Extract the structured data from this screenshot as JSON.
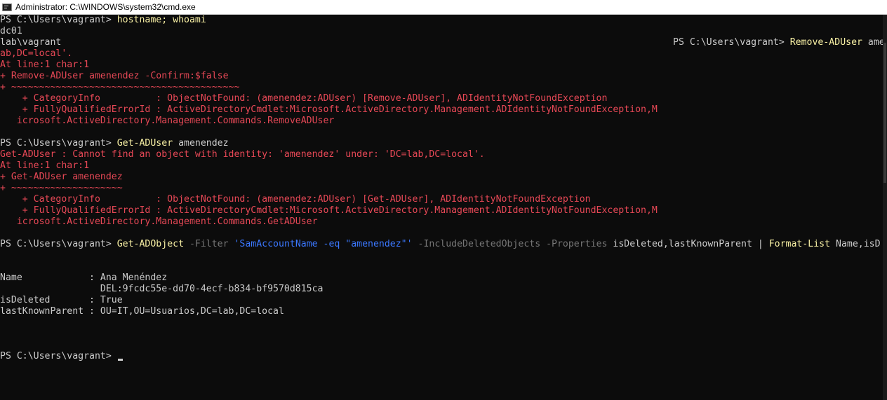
{
  "window": {
    "title": "Administrator: C:\\WINDOWS\\system32\\cmd.exe",
    "icon": "console-icon"
  },
  "terminal": {
    "colors": {
      "background": "#0c0c0c",
      "text": "#cccccc",
      "command": "#f9f1a5",
      "error": "#e74856",
      "parameter": "#767676",
      "string": "#3b78ff"
    },
    "prompt": "PS C:\\Users\\vagrant> ",
    "cmd1": {
      "command": "hostname; whoami"
    },
    "out1": [
      "dc01",
      "lab\\vagrant"
    ],
    "wrapped_prompt": "PS C:\\Users\\vagrant> ",
    "wrapped_command": "Remove-ADUser",
    "wrapped_arg": " ame",
    "err1": [
      "ab,DC=local'.",
      "At line:1 char:1",
      "+ Remove-ADUser amenendez -Confirm:$false",
      "+ ~~~~~~~~~~~~~~~~~~~~~~~~~~~~~~~~~~~~~~~~~",
      "    + CategoryInfo          : ObjectNotFound: (amenendez:ADUser) [Remove-ADUser], ADIdentityNotFoundException",
      "    + FullyQualifiedErrorId : ActiveDirectoryCmdlet:Microsoft.ActiveDirectory.Management.ADIdentityNotFoundException,M",
      "   icrosoft.ActiveDirectory.Management.Commands.RemoveADUser"
    ],
    "cmd2": {
      "command": "Get-ADUser",
      "args": " amenendez"
    },
    "err2": [
      "Get-ADUser : Cannot find an object with identity: 'amenendez' under: 'DC=lab,DC=local'.",
      "At line:1 char:1",
      "+ Get-ADUser amenendez",
      "+ ~~~~~~~~~~~~~~~~~~~~",
      "    + CategoryInfo          : ObjectNotFound: (amenendez:ADUser) [Get-ADUser], ADIdentityNotFoundException",
      "    + FullyQualifiedErrorId : ActiveDirectoryCmdlet:Microsoft.ActiveDirectory.Management.ADIdentityNotFoundException,M",
      "   icrosoft.ActiveDirectory.Management.Commands.GetADUser"
    ],
    "cmd3": {
      "command": "Get-ADObject",
      "p1": " -Filter ",
      "s1": "'SamAccountName -eq \"amenendez\"'",
      "p2": " -IncludeDeletedObjects -Properties ",
      "a1": "isDeleted,lastKnownParent",
      "pipe": " | ",
      "command2": "Format-List",
      "a2": " Name,isD"
    },
    "list": [
      "Name            : Ana Menéndez",
      "                  DEL:9fcdc55e-dd70-4ecf-b834-bf9570d815ca",
      "isDeleted       : True",
      "lastKnownParent : OU=IT,OU=Usuarios,DC=lab,DC=local"
    ],
    "final_prompt": "PS C:\\Users\\vagrant> "
  }
}
